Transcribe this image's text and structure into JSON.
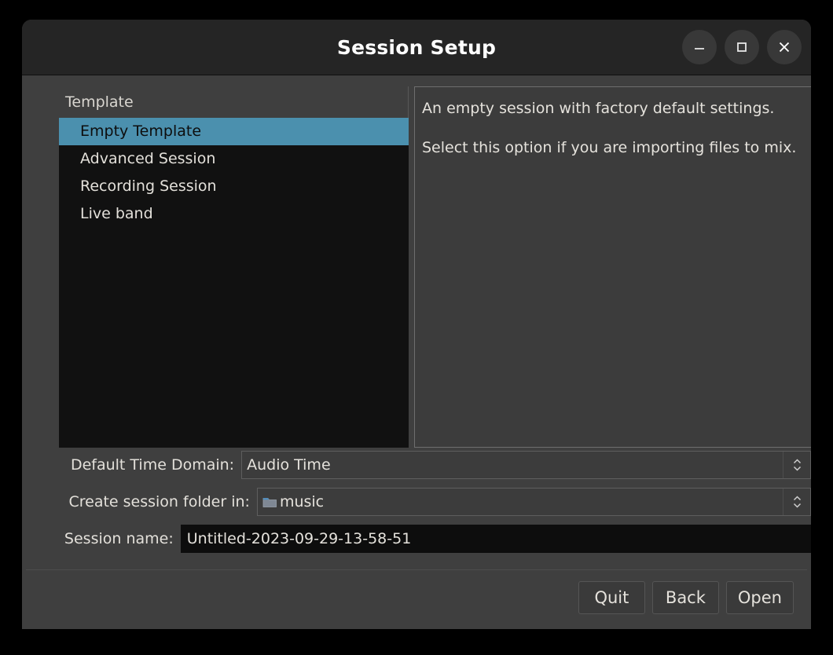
{
  "window": {
    "title": "Session Setup",
    "controls": {
      "minimize_label": "minimize",
      "maximize_label": "maximize",
      "close_label": "close"
    }
  },
  "template_list": {
    "header": "Template",
    "items": [
      {
        "label": "Empty Template",
        "selected": true
      },
      {
        "label": "Advanced Session",
        "selected": false
      },
      {
        "label": "Recording Session",
        "selected": false
      },
      {
        "label": "Live band",
        "selected": false
      }
    ],
    "selected_index": 0,
    "selection_color": "#4b90ae"
  },
  "description": {
    "paragraphs": [
      "An empty session with factory default settings.",
      "Select this option if you are importing files to mix."
    ]
  },
  "form": {
    "time_domain": {
      "label": "Default Time Domain:",
      "value": "Audio Time"
    },
    "session_folder": {
      "label": "Create session folder in:",
      "value": "music",
      "icon": "folder-icon"
    },
    "session_name": {
      "label": "Session name:",
      "value": "Untitled-2023-09-29-13-58-51",
      "placeholder": ""
    }
  },
  "footer": {
    "quit_label": "Quit",
    "back_label": "Back",
    "open_label": "Open"
  }
}
